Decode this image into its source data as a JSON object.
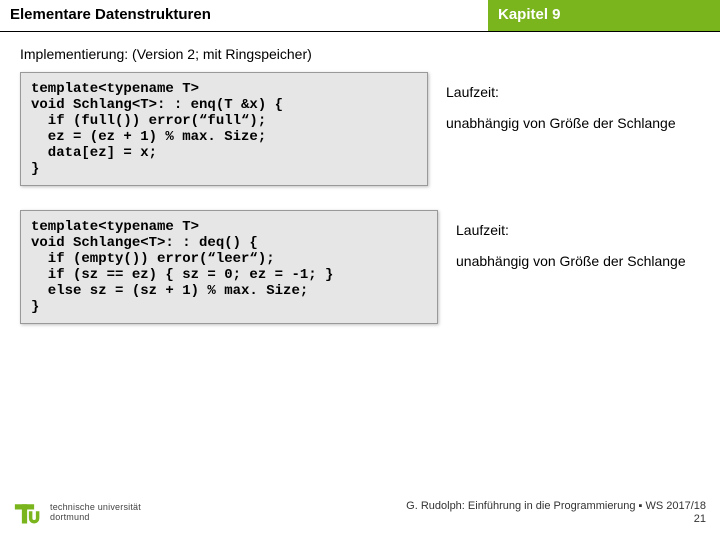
{
  "header": {
    "left": "Elementare Datenstrukturen",
    "right": "Kapitel 9"
  },
  "subheading": "Implementierung: (Version 2; mit Ringspeicher)",
  "blocks": [
    {
      "code": "template<typename T>\nvoid Schlang<T>: : enq(T &x) {\n  if (full()) error(“full“);\n  ez = (ez + 1) % max. Size;\n  data[ez] = x;\n}",
      "runtime_label": "Laufzeit:",
      "runtime_text": "unabhängig von Größe der Schlange"
    },
    {
      "code": "template<typename T>\nvoid Schlange<T>: : deq() {\n  if (empty()) error(“leer“);\n  if (sz == ez) { sz = 0; ez = -1; }\n  else sz = (sz + 1) % max. Size;\n}",
      "runtime_label": "Laufzeit:",
      "runtime_text": "unabhängig von Größe der Schlange"
    }
  ],
  "footer": {
    "logo_line1": "technische universität",
    "logo_line2": "dortmund",
    "credit": "G. Rudolph: Einführung in die Programmierung ▪ WS 2017/18",
    "slide_number": "21"
  }
}
